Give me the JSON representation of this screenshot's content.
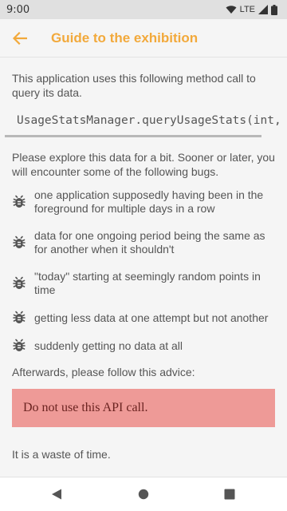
{
  "status_bar": {
    "time": "9:00",
    "network": "LTE"
  },
  "app_bar": {
    "title": "Guide to the exhibition"
  },
  "content": {
    "intro": "This application uses this following method call to query its data.",
    "code": "UsageStatsManager.queryUsageStats(int,",
    "explore": "Please explore this data for a bit. Sooner or later, you will encounter some of the following bugs.",
    "bugs": [
      "one application supposedly having been in the foreground for multiple days in a row",
      "data for one ongoing period being the same as for another when it shouldn't",
      "\"today\" starting at seemingly random points in time",
      "getting less data at one attempt but not another",
      "suddenly getting no data at all"
    ],
    "advice_intro": "Afterwards, please follow this advice:",
    "warning": "Do not use this API call.",
    "conclusion": "It is a waste of time."
  },
  "colors": {
    "accent": "#f2a93b",
    "warning_bg": "#ee9a97",
    "warning_text": "#6a2320"
  },
  "icons": {
    "back": "arrow-left-icon",
    "bug": "bug-icon",
    "nav_back": "triangle-back-icon",
    "nav_home": "circle-home-icon",
    "nav_recents": "square-recents-icon"
  }
}
